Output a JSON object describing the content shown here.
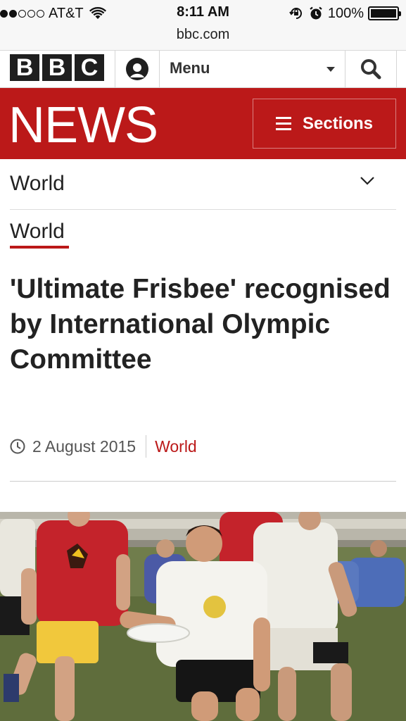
{
  "status_bar": {
    "carrier": "AT&T",
    "time": "8:11 AM",
    "battery": "100%",
    "url": "bbc.com"
  },
  "bbc_bar": {
    "logo_letters": [
      "B",
      "B",
      "C"
    ],
    "menu_label": "Menu"
  },
  "news_banner": {
    "title": "NEWS",
    "sections_label": "Sections"
  },
  "section_nav": {
    "current": "World"
  },
  "article": {
    "tag": "World",
    "headline": "'Ultimate Frisbee' recognised by International Olympic Committee",
    "date": "2 August 2015",
    "category": "World"
  },
  "colors": {
    "bbc_red": "#bb1919",
    "logo_dark": "#1f1f1f"
  },
  "icons": [
    "wifi-icon",
    "rotation-lock-icon",
    "alarm-icon",
    "battery-icon",
    "account-icon",
    "search-icon",
    "hamburger-icon",
    "chevron-down-icon",
    "clock-icon"
  ]
}
